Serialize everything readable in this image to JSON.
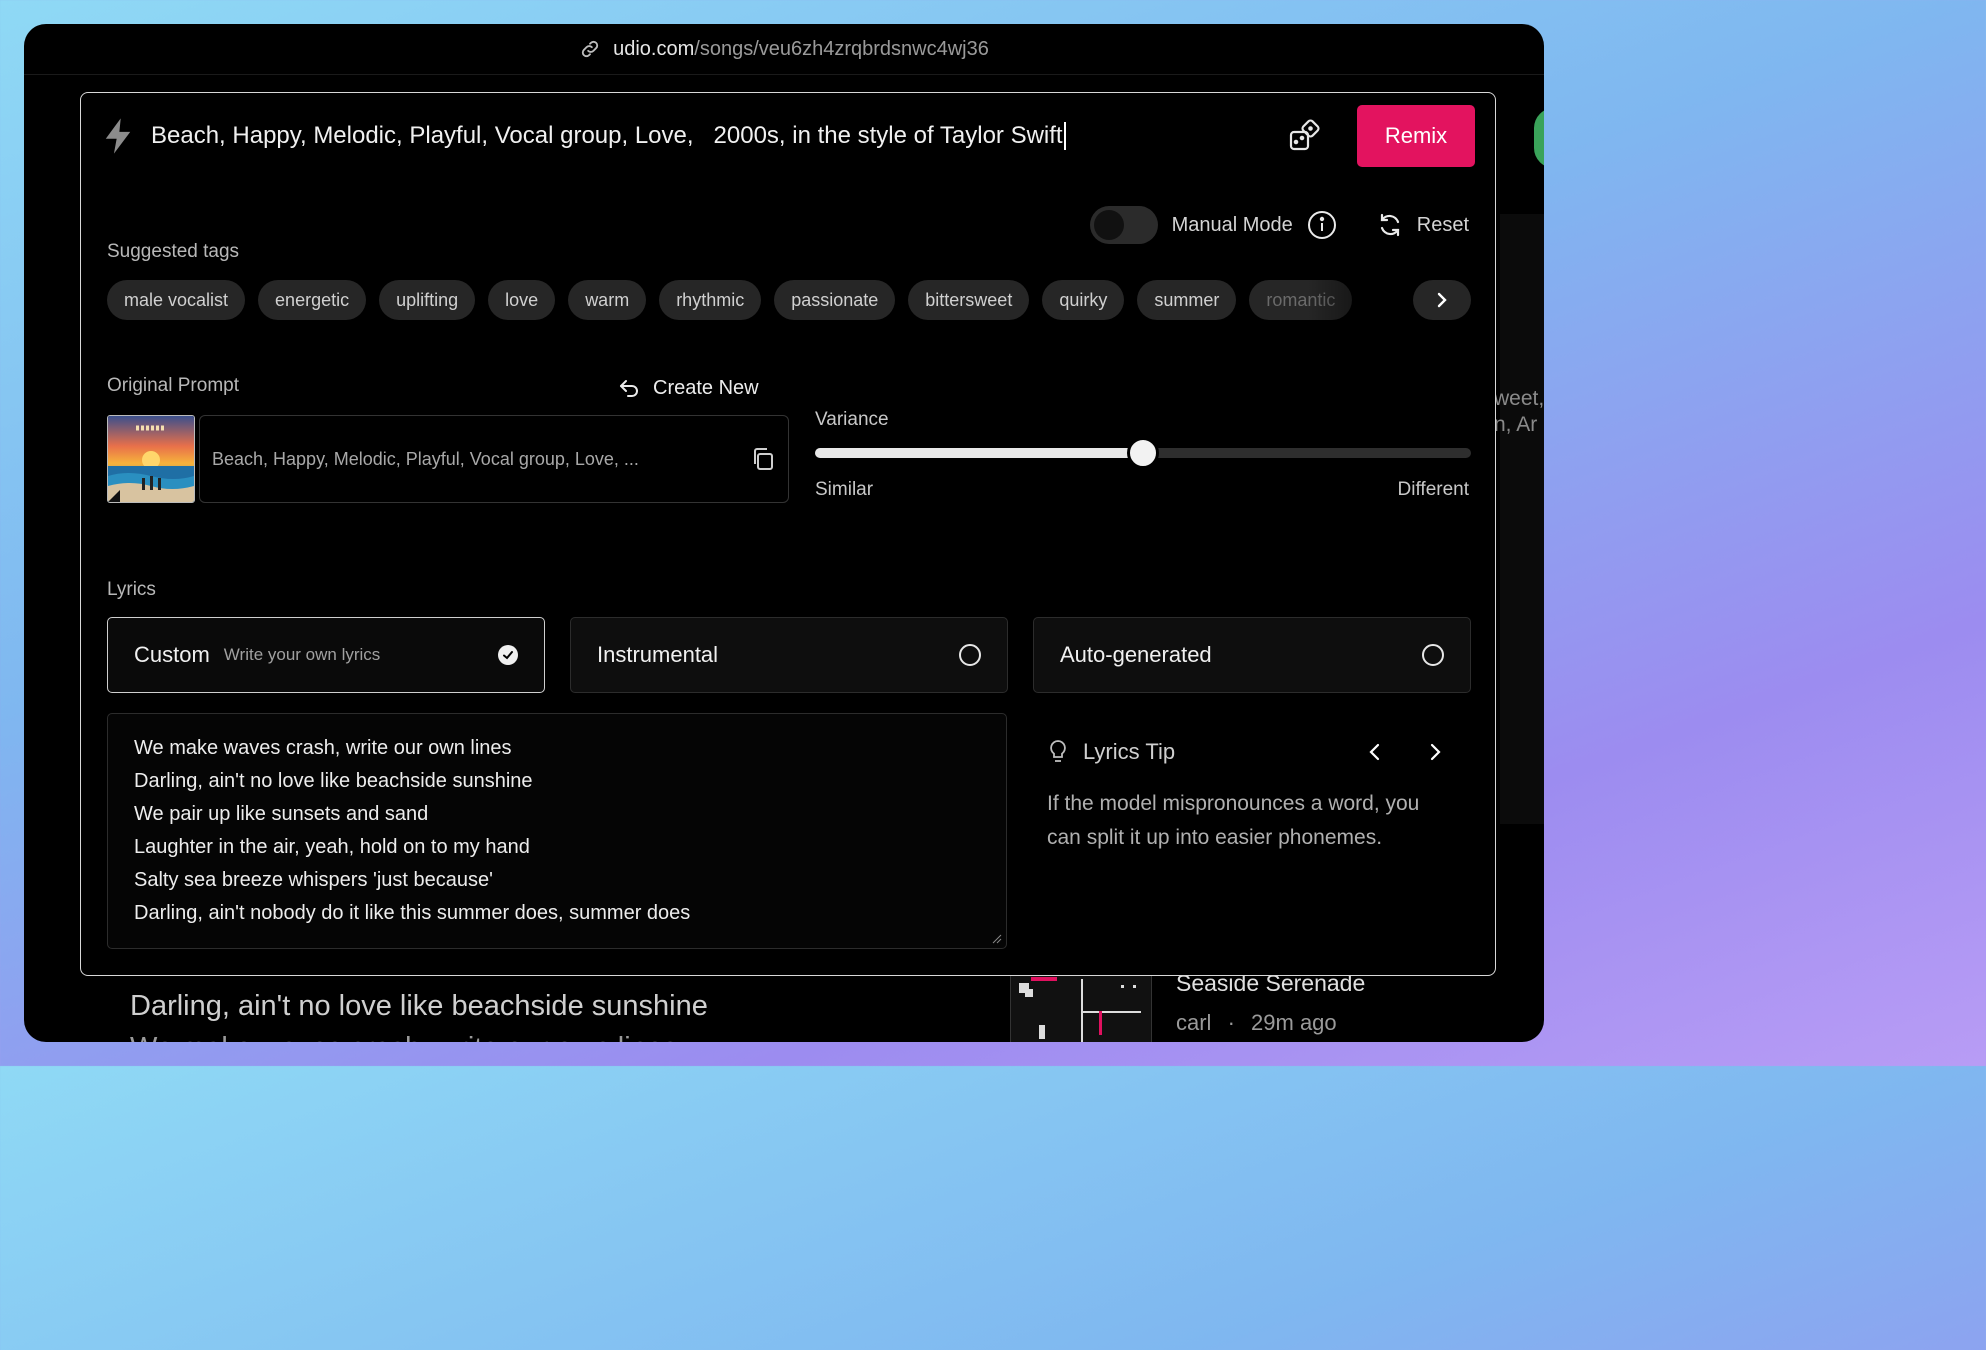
{
  "browser": {
    "url_host": "udio.com",
    "url_path": "/songs/veu6zh4zrqbrdsnwc4wj36"
  },
  "prompt": {
    "text": "Beach, Happy, Melodic, Playful, Vocal group, Love,   2000s, in the style of Taylor Swift",
    "remix_label": "Remix"
  },
  "controls": {
    "manual_mode_label": "Manual Mode",
    "manual_mode_on": false,
    "reset_label": "Reset"
  },
  "suggested_tags": {
    "label": "Suggested tags",
    "tags": [
      "male vocalist",
      "energetic",
      "uplifting",
      "love",
      "warm",
      "rhythmic",
      "passionate",
      "bittersweet",
      "quirky",
      "summer",
      "romantic"
    ]
  },
  "original_prompt": {
    "label": "Original Prompt",
    "create_new_label": "Create New",
    "text": "Beach, Happy, Melodic, Playful, Vocal group, Love,  ..."
  },
  "variance": {
    "label": "Variance",
    "min_label": "Similar",
    "max_label": "Different",
    "value": 0.5
  },
  "lyrics": {
    "label": "Lyrics",
    "options": [
      {
        "title": "Custom",
        "subtitle": "Write your own lyrics",
        "selected": true
      },
      {
        "title": "Instrumental",
        "subtitle": "",
        "selected": false
      },
      {
        "title": "Auto-generated",
        "subtitle": "",
        "selected": false
      }
    ],
    "lines": [
      "We make waves crash, write our own lines",
      "Darling, ain't no love like beachside sunshine",
      "We pair up like sunsets and sand",
      "Laughter in the air, yeah, hold on to my hand",
      "Salty sea breeze whispers 'just because'",
      "Darling, ain't nobody do it like this summer does, summer does"
    ]
  },
  "lyrics_tip": {
    "title": "Lyrics Tip",
    "body": "If the model mispronounces a word, you can split it up into easier phonemes."
  },
  "background": {
    "lyric_line": "Darling, ain't no love like beachside sunshine",
    "next_line": "We make waves crash, write our own lines",
    "edge_text": "weet,\nn, Ar",
    "song_title": "Seaside Serenade",
    "song_author": "carl",
    "song_time": "29m ago",
    "song_separator": "·"
  },
  "colors": {
    "accent": "#e3135f",
    "background": "#000000"
  }
}
